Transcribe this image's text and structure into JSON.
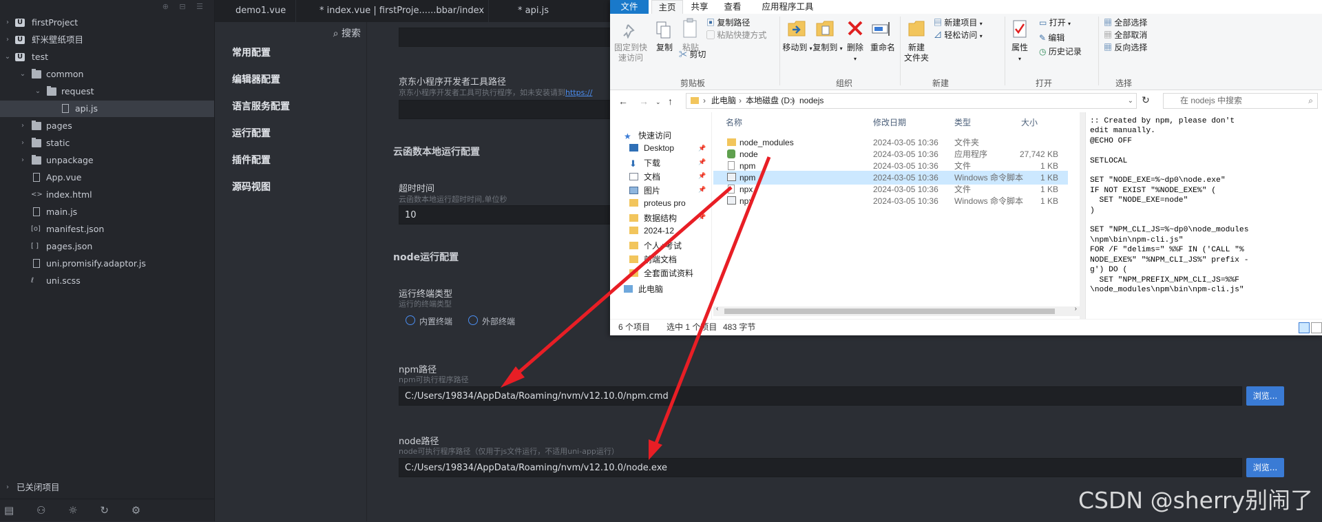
{
  "tree": {
    "items": [
      {
        "label": "firstProject"
      },
      {
        "label": "虾米壁纸项目"
      },
      {
        "label": "test"
      },
      {
        "label": "common"
      },
      {
        "label": "request"
      },
      {
        "label": "api.js"
      },
      {
        "label": "pages"
      },
      {
        "label": "static"
      },
      {
        "label": "unpackage"
      },
      {
        "label": "App.vue"
      },
      {
        "label": "index.html"
      },
      {
        "label": "main.js"
      },
      {
        "label": "manifest.json"
      },
      {
        "label": "pages.json"
      },
      {
        "label": "uni.promisify.adaptor.js"
      },
      {
        "label": "uni.scss"
      }
    ],
    "closed_projects": "已关闭项目"
  },
  "tabs": [
    {
      "label": "demo1.vue"
    },
    {
      "label": "* index.vue | firstProje......bbar/index"
    },
    {
      "label": "* api.js"
    }
  ],
  "settings_nav": {
    "search": "搜索",
    "items": [
      "常用配置",
      "编辑器配置",
      "语言服务配置",
      "运行配置",
      "插件配置",
      "源码视图"
    ]
  },
  "settings": {
    "jd_title": "京东小程序开发者工具路径",
    "jd_desc": "京东小程序开发者工具可执行程序，如未安装请到",
    "jd_link": "https://",
    "cloud_section": "云函数本地运行配置",
    "timeout_title": "超时时间",
    "timeout_desc": "云函数本地运行超时时间,单位秒",
    "timeout_value": "10",
    "node_section": "node运行配置",
    "terminal_title": "运行终端类型",
    "terminal_desc": "运行的终端类型",
    "terminal_opt1": "内置终端",
    "terminal_opt2": "外部终端",
    "npm_title": "npm路径",
    "npm_desc": "npm可执行程序路径",
    "npm_value": "C:/Users/19834/AppData/Roaming/nvm/v12.10.0/npm.cmd",
    "node_title": "node路径",
    "node_desc": "node可执行程序路径（仅用于js文件运行，不适用uni-app运行）",
    "node_value": "C:/Users/19834/AppData/Roaming/nvm/v12.10.0/node.exe",
    "browse": "浏览..."
  },
  "explorer": {
    "ribbon_tabs": [
      "文件",
      "主页",
      "共享",
      "查看",
      "应用程序工具"
    ],
    "clipboard": {
      "pin": "固定到快\n速访问",
      "copy": "复制",
      "paste": "粘贴",
      "copy_path": "复制路径",
      "paste_shortcut": "粘贴快捷方式",
      "cut": "剪切",
      "group": "剪贴板"
    },
    "organize": {
      "move": "移动到",
      "copyto": "复制到",
      "delete": "删除",
      "rename": "重命名",
      "group": "组织"
    },
    "new": {
      "folder": "新建\n文件夹",
      "new_item": "新建项目",
      "easy_access": "轻松访问",
      "group": "新建"
    },
    "open": {
      "props": "属性",
      "open": "打开",
      "edit": "编辑",
      "history": "历史记录",
      "group": "打开"
    },
    "select": {
      "all": "全部选择",
      "none": "全部取消",
      "invert": "反向选择",
      "group": "选择"
    },
    "breadcrumb": [
      "此电脑",
      "本地磁盘 (D:)",
      "nodejs"
    ],
    "search_placeholder": "在 nodejs 中搜索",
    "nav": [
      {
        "label": "快速访问"
      },
      {
        "label": "Desktop"
      },
      {
        "label": "下载"
      },
      {
        "label": "文档"
      },
      {
        "label": "图片"
      },
      {
        "label": "proteus pro"
      },
      {
        "label": "数据结构"
      },
      {
        "label": "2024-12"
      },
      {
        "label": "个人+考试"
      },
      {
        "label": "前端文档"
      },
      {
        "label": "全套面试资料"
      },
      {
        "label": "此电脑"
      }
    ],
    "columns": {
      "name": "名称",
      "date": "修改日期",
      "type": "类型",
      "size": "大小"
    },
    "files": [
      {
        "name": "node_modules",
        "date": "2024-03-05 10:36",
        "type": "文件夹",
        "size": ""
      },
      {
        "name": "node",
        "date": "2024-03-05 10:36",
        "type": "应用程序",
        "size": "27,742 KB"
      },
      {
        "name": "npm",
        "date": "2024-03-05 10:36",
        "type": "文件",
        "size": "1 KB"
      },
      {
        "name": "npm",
        "date": "2024-03-05 10:36",
        "type": "Windows 命令脚本",
        "size": "1 KB"
      },
      {
        "name": "npx",
        "date": "2024-03-05 10:36",
        "type": "文件",
        "size": "1 KB"
      },
      {
        "name": "npx",
        "date": "2024-03-05 10:36",
        "type": "Windows 命令脚本",
        "size": "1 KB"
      }
    ],
    "preview_text": ":: Created by npm, please don't\nedit manually.\n@ECHO OFF\n\nSETLOCAL\n\nSET \"NODE_EXE=%~dp0\\node.exe\"\nIF NOT EXIST \"%NODE_EXE%\" (\n  SET \"NODE_EXE=node\"\n)\n\nSET \"NPM_CLI_JS=%~dp0\\node_modules\n\\npm\\bin\\npm-cli.js\"\nFOR /F \"delims=\" %%F IN ('CALL \"%\nNODE_EXE%\" \"%NPM_CLI_JS%\" prefix -\ng') DO (\n  SET \"NPM_PREFIX_NPM_CLI_JS=%%F\n\\node_modules\\npm\\bin\\npm-cli.js\"",
    "status": {
      "count": "6 个项目",
      "selected": "选中 1 个项目",
      "size": "483 字节"
    }
  },
  "watermark": "CSDN @sherry别闹了",
  "colors": {
    "accent": "#3a7bd5",
    "arrow": "#e81e25",
    "selection": "#cce8ff"
  }
}
